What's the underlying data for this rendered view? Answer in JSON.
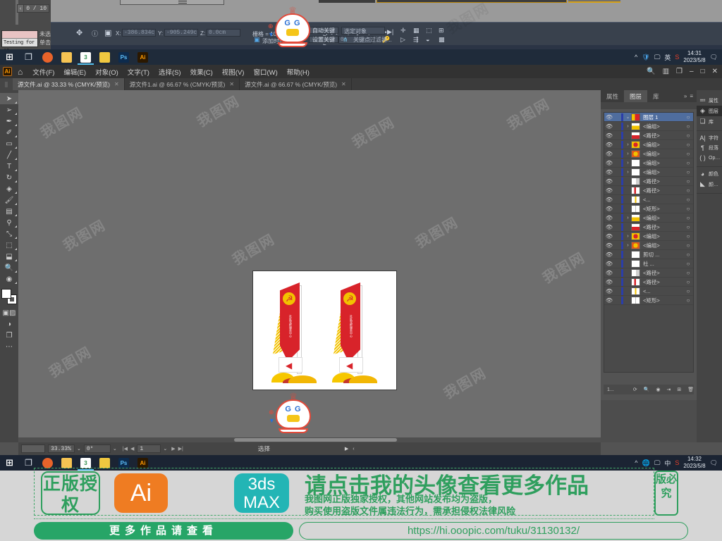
{
  "top_app": {
    "name": "3ds-max",
    "spinner_value": "0 / 10",
    "color_swatch_label": "Testing for AI",
    "side_labels": [
      "未选",
      "单击"
    ],
    "coords": {
      "x_label": "X:",
      "x_value": "-386.834c",
      "y_label": "Y:",
      "y_value": "-905.249c",
      "z_label": "Z:",
      "z_value": "0.0cm"
    },
    "grid_label": "栅格 = 10.0cm",
    "time_tag_label": "添加时间标记",
    "frame_value": "0",
    "auto_key_label": "自动关键点",
    "set_key_label": "设置关键点",
    "select_object_label": "选定对象",
    "key_filter_label": "关键点过滤器...",
    "taskbar_time": "14:31",
    "taskbar_date": "2023/5/8"
  },
  "illustrator": {
    "logo": "Ai",
    "home_icon": "home-icon",
    "menus": [
      "文件(F)",
      "编辑(E)",
      "对象(O)",
      "文字(T)",
      "选择(S)",
      "效果(C)",
      "视图(V)",
      "窗口(W)",
      "帮助(H)"
    ],
    "window_controls": {
      "search": "search-icon",
      "arrange": "arrange-icon",
      "workspace": "workspace-icon",
      "minimize": "–",
      "maximize": "□",
      "close": "✕"
    },
    "tabs": [
      {
        "label": "源文件.ai @ 33.33 % (CMYK/预览)",
        "close": "✕",
        "active": true
      },
      {
        "label": "源文件1.ai @ 66.67 % (CMYK/预览)",
        "close": "✕",
        "active": false
      },
      {
        "label": "源文件.ai @ 66.67 % (CMYK/预览)",
        "close": "✕",
        "active": false
      }
    ],
    "tools": [
      "selection-tool",
      "direct-selection-tool",
      "pen-tool",
      "curvature-tool",
      "rectangle-tool",
      "line-segment-tool",
      "type-tool",
      "rotate-tool",
      "shape-builder-tool",
      "paintbrush-tool",
      "gradient-tool",
      "eyedropper-tool",
      "scale-tool",
      "free-transform-tool",
      "artboard-tool",
      "zoom-tool",
      "blend-tool"
    ],
    "status_bar": {
      "zoom": "33.33%",
      "rotation": "0°",
      "page_first": "|◀",
      "page_prev": "◀",
      "page_value": "1",
      "page_next": "▶",
      "page_last": "▶|",
      "tool_label": "选择"
    },
    "taskbar_time": "14:32",
    "taskbar_date": "2023/5/8"
  },
  "layers_panel": {
    "tabs": [
      {
        "label": "属性",
        "active": false
      },
      {
        "label": "图层",
        "active": true
      },
      {
        "label": "库",
        "active": false
      }
    ],
    "overflow": "»",
    "menu": "≡",
    "rows": [
      {
        "name": "图层 1",
        "expand": "⌄",
        "selected": true,
        "thumb": "layer-thumb-flag",
        "eye": "eye-icon",
        "target": "○"
      },
      {
        "name": "<编组>",
        "expand": "›",
        "selected": false,
        "thumb": "layer-thumb-gold",
        "eye": "eye-icon",
        "target": "○"
      },
      {
        "name": "<路径>",
        "expand": "",
        "selected": false,
        "thumb": "layer-thumb-red",
        "eye": "eye-icon",
        "target": "○"
      },
      {
        "name": "<编组>",
        "expand": "›",
        "selected": false,
        "thumb": "layer-thumb-emblem",
        "eye": "eye-icon",
        "target": "○"
      },
      {
        "name": "<编组>",
        "expand": "›",
        "selected": false,
        "thumb": "layer-thumb-badge",
        "eye": "eye-icon",
        "target": "○"
      },
      {
        "name": "<编组>",
        "expand": "›",
        "selected": false,
        "thumb": "layer-thumb-white",
        "eye": "eye-icon",
        "target": "○"
      },
      {
        "name": "<编组>",
        "expand": "›",
        "selected": false,
        "thumb": "layer-thumb-white",
        "eye": "eye-icon",
        "target": "○"
      },
      {
        "name": "<路径>",
        "expand": "",
        "selected": false,
        "thumb": "layer-thumb-arrow",
        "eye": "eye-icon",
        "target": "○"
      },
      {
        "name": "<路径>",
        "expand": "",
        "selected": false,
        "thumb": "layer-thumb-stripe",
        "eye": "eye-icon",
        "target": "○"
      },
      {
        "name": "<...",
        "expand": "",
        "selected": false,
        "thumb": "layer-thumb-yellow",
        "eye": "eye-icon",
        "target": "○"
      },
      {
        "name": "<矩形>",
        "expand": "",
        "selected": false,
        "thumb": "layer-thumb-rect",
        "eye": "eye-icon",
        "target": "○"
      },
      {
        "name": "<编组>",
        "expand": "›",
        "selected": false,
        "thumb": "layer-thumb-gold",
        "eye": "eye-icon",
        "target": "○"
      },
      {
        "name": "<路径>",
        "expand": "",
        "selected": false,
        "thumb": "layer-thumb-red",
        "eye": "eye-icon",
        "target": "○"
      },
      {
        "name": "<编组>",
        "expand": "›",
        "selected": false,
        "thumb": "layer-thumb-emblem",
        "eye": "eye-icon",
        "target": "○"
      },
      {
        "name": "<编组>",
        "expand": "›",
        "selected": false,
        "thumb": "layer-thumb-badge",
        "eye": "eye-icon",
        "target": "○"
      },
      {
        "name": "剪切 ...",
        "expand": "",
        "selected": false,
        "thumb": "layer-thumb-white",
        "eye": "eye-icon",
        "target": "○"
      },
      {
        "name": "社 ...",
        "expand": "",
        "selected": false,
        "thumb": "layer-thumb-white",
        "eye": "eye-icon",
        "target": "○"
      },
      {
        "name": "<路径>",
        "expand": "",
        "selected": false,
        "thumb": "layer-thumb-arrow",
        "eye": "eye-icon",
        "target": "○"
      },
      {
        "name": "<路径>",
        "expand": "",
        "selected": false,
        "thumb": "layer-thumb-stripe",
        "eye": "eye-icon",
        "target": "○"
      },
      {
        "name": "<...",
        "expand": "",
        "selected": false,
        "thumb": "layer-thumb-yellow",
        "eye": "eye-icon",
        "target": "○"
      },
      {
        "name": "<矩形>",
        "expand": "",
        "selected": false,
        "thumb": "layer-thumb-rect",
        "eye": "eye-icon",
        "target": "○"
      }
    ],
    "footer": {
      "count": "1...",
      "buttons": [
        "locate-object-icon",
        "search-icon",
        "make-clipping-mask-icon",
        "create-sublayer-icon",
        "new-layer-icon",
        "delete-layer-icon"
      ]
    },
    "dock_icons": [
      {
        "glyph": "≕",
        "label": "属性",
        "name": "properties-dock-icon",
        "active": false
      },
      {
        "glyph": "◈",
        "label": "图层",
        "name": "layers-dock-icon",
        "active": true
      },
      {
        "glyph": "❏",
        "label": "库",
        "name": "libraries-dock-icon",
        "active": false
      },
      {
        "glyph": "A|",
        "label": "字符",
        "name": "character-dock-icon",
        "active": false
      },
      {
        "glyph": "¶",
        "label": "段落",
        "name": "paragraph-dock-icon",
        "active": false
      },
      {
        "glyph": "( )",
        "label": "Op…",
        "name": "opentype-dock-icon",
        "active": false
      },
      {
        "glyph": "◕",
        "label": "颜色",
        "name": "color-dock-icon",
        "active": false
      },
      {
        "glyph": "◣",
        "label": "颜…",
        "name": "color-guide-dock-icon",
        "active": false
      }
    ]
  },
  "artwork": {
    "description": "两个党建宣传立柱设计",
    "pylon_text": "社区党群服务中心"
  },
  "taskbar": {
    "items": [
      {
        "name": "start-button",
        "glyph": "⊞",
        "kind": "ic-win"
      },
      {
        "name": "task-view-button",
        "glyph": "❐",
        "kind": "ic-task"
      },
      {
        "name": "firefox-button",
        "glyph": "",
        "kind": "ic-ff"
      },
      {
        "name": "file-explorer-button",
        "glyph": "",
        "kind": "ic-folder"
      },
      {
        "name": "3dsmax-button",
        "glyph": "3",
        "kind": "ic-3ds"
      },
      {
        "name": "gallery-button",
        "glyph": "",
        "kind": "ic-gal"
      },
      {
        "name": "photoshop-button",
        "glyph": "Ps",
        "kind": "ic-ps"
      },
      {
        "name": "illustrator-button",
        "glyph": "Ai",
        "kind": "ic-ai"
      }
    ],
    "tray": {
      "chevron": "^",
      "network": "🌐",
      "display": "🖵",
      "ime": "中",
      "snip": "S",
      "notifications": "🗨"
    }
  },
  "banner": {
    "seal_left": "正版授权",
    "ai_badge": "Ai",
    "max_badge": "3ds MAX",
    "headline": "请点击我的头像查看更多作品",
    "sub_line_1": "我图网正版独家授权，其他网站发布均为盗版，",
    "sub_line_2": "购买使用盗版文件属违法行为，需承担侵权法律风险",
    "seal_right": "版必究",
    "cta": "更多作品请查看",
    "url": "https://hi.ooopic.com/tuku/31130132/"
  },
  "watermark": {
    "text": "我图网"
  },
  "colors": {
    "accent_green": "#2f9f5e",
    "cta_green": "#27a567",
    "ai_orange": "#ef7c22",
    "max_teal": "#23b5b5",
    "layer_select_blue": "#4f6d9e",
    "panel_bg": "#535353",
    "canvas_bg": "#6e6e6e"
  }
}
